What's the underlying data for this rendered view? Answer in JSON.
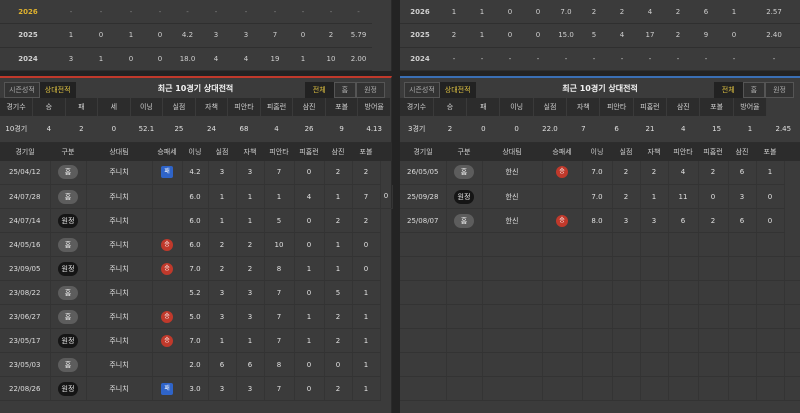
{
  "left_top": {
    "rows": [
      {
        "year": "2026",
        "cells": [
          "-",
          "-",
          "-",
          "-",
          "-",
          "-",
          "-",
          "-",
          "-",
          "-",
          "-"
        ]
      },
      {
        "year": "2025",
        "cells": [
          "1",
          "0",
          "1",
          "0",
          "4.2",
          "3",
          "3",
          "7",
          "0",
          "2",
          "5.79"
        ]
      },
      {
        "year": "2024",
        "cells": [
          "3",
          "1",
          "0",
          "0",
          "18.0",
          "4",
          "4",
          "19",
          "1",
          "10",
          "2.00"
        ]
      }
    ],
    "row_2025_extra": "2",
    "row_2024_extra": "2"
  },
  "right_top": {
    "rows": [
      {
        "year": "2026",
        "cells": [
          "1",
          "1",
          "0",
          "0",
          "7.0",
          "2",
          "2",
          "4",
          "2",
          "6",
          "1",
          "2.57"
        ]
      },
      {
        "year": "2025",
        "cells": [
          "2",
          "1",
          "0",
          "0",
          "15.0",
          "5",
          "4",
          "17",
          "2",
          "9",
          "0",
          "2.40"
        ]
      },
      {
        "year": "2024",
        "cells": [
          "-",
          "-",
          "-",
          "-",
          "-",
          "-",
          "-",
          "-",
          "-",
          "-",
          "-",
          "-"
        ]
      }
    ]
  },
  "left": {
    "tab_season": "시즌성적",
    "tab_h2h": "상대전적",
    "title": "최근 10경기 상대전적",
    "seg_all": "전체",
    "seg_home": "홈",
    "seg_away": "원정",
    "summary_headers": [
      "경기수",
      "승",
      "패",
      "세",
      "이닝",
      "실점",
      "자책",
      "피안타",
      "피홈런",
      "삼진",
      "포볼",
      "방어율"
    ],
    "summary_values": [
      "10경기",
      "4",
      "2",
      "0",
      "52.1",
      "25",
      "24",
      "68",
      "4",
      "26",
      "9",
      "4.13"
    ],
    "record_headers": [
      "경기일",
      "구분",
      "상대팀",
      "승패세",
      "이닝",
      "실점",
      "자책",
      "피안타",
      "피홈런",
      "삼진",
      "포볼"
    ],
    "records": [
      {
        "date": "25/04/12",
        "loc": "홈",
        "loc_type": "home",
        "opp": "주니치",
        "res": "패",
        "res_type": "loss",
        "stats": [
          "4.2",
          "3",
          "3",
          "7",
          "0",
          "2",
          "2"
        ]
      },
      {
        "date": "24/07/28",
        "loc": "홈",
        "loc_type": "home",
        "opp": "주니치",
        "res": "",
        "res_type": "",
        "stats": [
          "6.0",
          "1",
          "1",
          "1",
          "4",
          "1",
          "7",
          "0"
        ]
      },
      {
        "date": "24/07/14",
        "loc": "원정",
        "loc_type": "away",
        "opp": "주니치",
        "res": "",
        "res_type": "",
        "stats": [
          "6.0",
          "1",
          "1",
          "5",
          "0",
          "2",
          "2"
        ]
      },
      {
        "date": "24/05/16",
        "loc": "홈",
        "loc_type": "home",
        "opp": "주니치",
        "res": "승",
        "res_type": "win",
        "stats": [
          "6.0",
          "2",
          "2",
          "10",
          "0",
          "1",
          "0"
        ]
      },
      {
        "date": "23/09/05",
        "loc": "원정",
        "loc_type": "away",
        "opp": "주니치",
        "res": "승",
        "res_type": "win",
        "stats": [
          "7.0",
          "2",
          "2",
          "8",
          "1",
          "1",
          "0"
        ]
      },
      {
        "date": "23/08/22",
        "loc": "홈",
        "loc_type": "home",
        "opp": "주니치",
        "res": "",
        "res_type": "",
        "stats": [
          "5.2",
          "3",
          "3",
          "7",
          "0",
          "5",
          "1"
        ]
      },
      {
        "date": "23/06/27",
        "loc": "홈",
        "loc_type": "home",
        "opp": "주니치",
        "res": "승",
        "res_type": "win",
        "stats": [
          "5.0",
          "3",
          "3",
          "7",
          "1",
          "2",
          "1"
        ]
      },
      {
        "date": "23/05/17",
        "loc": "원정",
        "loc_type": "away",
        "opp": "주니치",
        "res": "승",
        "res_type": "win",
        "stats": [
          "7.0",
          "1",
          "1",
          "7",
          "1",
          "2",
          "1"
        ]
      },
      {
        "date": "23/05/03",
        "loc": "홈",
        "loc_type": "home",
        "opp": "주니치",
        "res": "",
        "res_type": "",
        "stats": [
          "2.0",
          "6",
          "6",
          "8",
          "0",
          "0",
          "1"
        ]
      },
      {
        "date": "22/08/26",
        "loc": "원정",
        "loc_type": "away",
        "opp": "주니치",
        "res": "패",
        "res_type": "loss",
        "stats": [
          "3.0",
          "3",
          "3",
          "7",
          "0",
          "2",
          "1"
        ]
      }
    ]
  },
  "right": {
    "tab_season": "시즌성적",
    "tab_h2h": "상대전적",
    "title": "최근 10경기 상대전적",
    "seg_all": "전체",
    "seg_home": "홈",
    "seg_away": "원정",
    "summary_headers": [
      "경기수",
      "승",
      "패",
      "이닝",
      "실점",
      "자책",
      "피안타",
      "피홈런",
      "삼진",
      "포볼",
      "방어율"
    ],
    "summary_values": [
      "3경기",
      "2",
      "0",
      "0",
      "22.0",
      "7",
      "6",
      "21",
      "4",
      "15",
      "1",
      "2.45"
    ],
    "record_headers": [
      "경기일",
      "구분",
      "상대팀",
      "승패세",
      "이닝",
      "실점",
      "자책",
      "피안타",
      "피홈런",
      "삼진",
      "포볼"
    ],
    "records": [
      {
        "date": "26/05/05",
        "loc": "홈",
        "loc_type": "home",
        "opp": "한신",
        "res": "승",
        "res_type": "win",
        "stats": [
          "7.0",
          "2",
          "2",
          "4",
          "2",
          "6",
          "1"
        ]
      },
      {
        "date": "25/09/28",
        "loc": "원정",
        "loc_type": "away",
        "opp": "한신",
        "res": "",
        "res_type": "",
        "stats": [
          "7.0",
          "2",
          "1",
          "11",
          "0",
          "3",
          "0"
        ]
      },
      {
        "date": "25/08/07",
        "loc": "홈",
        "loc_type": "home",
        "opp": "한신",
        "res": "승",
        "res_type": "win",
        "stats": [
          "8.0",
          "3",
          "3",
          "6",
          "2",
          "6",
          "0"
        ]
      }
    ]
  }
}
